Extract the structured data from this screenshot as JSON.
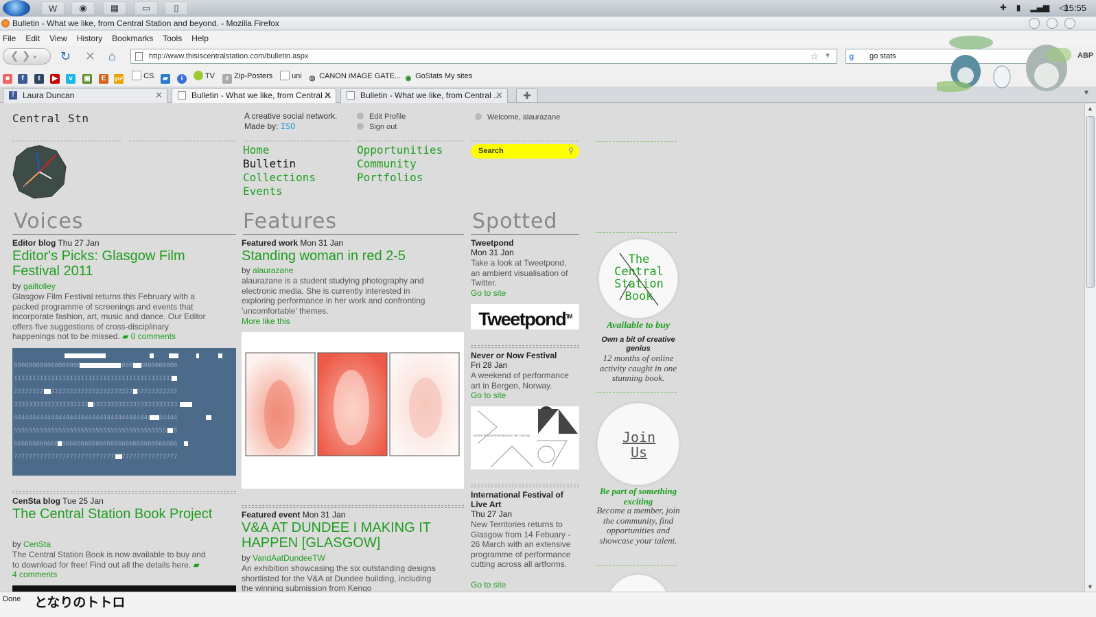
{
  "taskbar": {
    "clock": "15:55"
  },
  "window": {
    "title": "Bulletin - What we like, from Central Station and beyond. - Mozilla Firefox"
  },
  "menu": [
    "File",
    "Edit",
    "View",
    "History",
    "Bookmarks",
    "Tools",
    "Help"
  ],
  "toolbar": {
    "url": "http://www.thisiscentralstation.com/bulletin.aspx",
    "search_value": "go stats",
    "abp": "ABP"
  },
  "bookmarks": {
    "cs": "CS",
    "tv": "TV",
    "zip": "Zip-Posters",
    "uni": "uni",
    "canon": "CANON iMAGE GATE...",
    "gostats": "GoStats My sites"
  },
  "tabs": [
    {
      "label": "Laura Duncan"
    },
    {
      "label": "Bulletin - What we like, from Central ..."
    },
    {
      "label": "Bulletin - What we like, from Central ..."
    }
  ],
  "site": {
    "logo": "Central Stn",
    "tagline1": "A creative social network.",
    "tagline2": "Made by:",
    "tagline_link": "ISO",
    "edit_profile": "Edit Profile",
    "sign_out": "Sign out",
    "welcome": "Welcome, alaurazane",
    "nav_left": [
      "Home",
      "Bulletin",
      "Collections",
      "Events"
    ],
    "nav_right": [
      "Opportunities",
      "Community",
      "Portfolios"
    ],
    "search_placeholder": "Search"
  },
  "sections": {
    "voices": "Voices",
    "features": "Features",
    "spotted": "Spotted"
  },
  "voices": [
    {
      "type": "Editor blog",
      "date": "Thu 27 Jan",
      "title": "Editor's Picks: Glasgow Film Festival 2011",
      "by": "by",
      "author": "gailtolley",
      "body": "Glasgow Film Festival returns this February with a packed programme of screenings and events that incorporate fashion, art, music and dance. Our Editor offers five suggestions of cross-disciplinary happenings not to be missed.",
      "comments": "0 comments"
    },
    {
      "type": "CenSta blog",
      "date": "Tue 25 Jan",
      "title": "The Central Station Book Project",
      "by": "by",
      "author": "CenSta",
      "body": "The Central Station Book is now available to buy and to download for free! Find out all the details here.",
      "comments": "4 comments"
    }
  ],
  "features": [
    {
      "type": "Featured work",
      "date": "Mon 31 Jan",
      "title": "Standing woman in red 2-5",
      "by": "by",
      "author": "alaurazane",
      "body": "alaurazane is a student studying photography and electronic media. She is currently interested in exploring performance in her work and confronting 'uncomfortable' themes.",
      "more": "More like this"
    },
    {
      "type": "Featured event",
      "date": "Mon 31 Jan",
      "title": "V&A AT DUNDEE I MAKING IT HAPPEN [GLASGOW]",
      "by": "by",
      "author": "VandAatDundeeTW",
      "body": "An exhibition showcasing the six outstanding designs shortlisted for the V&A at Dundee building, including the winning submission from Kengo"
    }
  ],
  "spotted": [
    {
      "title": "Tweetpond",
      "date": "Mon 31 Jan",
      "body": "Take a look at Tweetpond, an ambient visualisation of Twitter.",
      "link": "Go to site",
      "logo": "Tweetpond",
      "tm": "TM"
    },
    {
      "title": "Never or Now Festival",
      "date": "Fri 28 Jan",
      "body": "A weekend of performance art in Bergen, Norway.",
      "link": "Go to site",
      "poster_text": "NEVER OR NOW  PERFORMANCE ART FESTIVAL"
    },
    {
      "title": "International Festival of Live Art",
      "date": "Thu 27 Jan",
      "body": "New Territories returns to Glasgow from 14 Febuary - 26 March with an extensive programme of performance cutting across all artforms.",
      "link": "Go to site"
    }
  ],
  "promo": {
    "book_title": [
      "The",
      "Central",
      "Station",
      "Book"
    ],
    "available": "Available to buy",
    "genius": "Own a bit of creative genius",
    "months": "12 months of online activity caught in one stunning book.",
    "join": [
      "Join",
      "Us"
    ],
    "be_part": "Be part of something exciting",
    "become": "Become a member, join the community, find opportunities and showcase your talent."
  },
  "status": {
    "text": "Done",
    "deco": "となりのトトロ"
  },
  "colors": {
    "accent": "#1e9d1e",
    "search_bg": "#ffff00",
    "link_blue": "#1a9fd0"
  }
}
